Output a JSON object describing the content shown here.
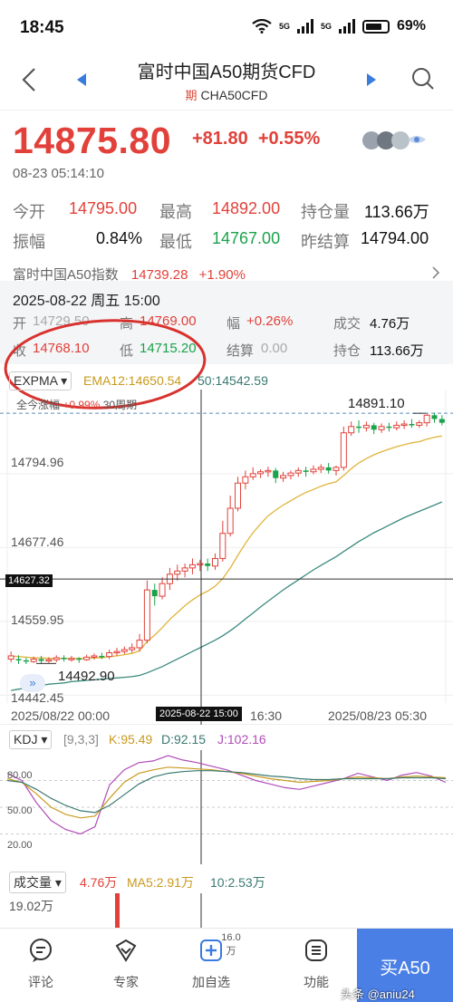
{
  "status_bar": {
    "time": "18:45",
    "net1": "5G",
    "net2": "5G",
    "battery": "69%"
  },
  "header": {
    "title": "富时中国A50期货CFD",
    "tag": "期",
    "code": "CHA50CFD"
  },
  "quote": {
    "price": "14875.80",
    "change": "+81.80",
    "change_pct": "+0.55%",
    "timestamp": "08-23 05:14:10"
  },
  "stats": [
    [
      {
        "label": "今开",
        "value": "14795.00",
        "color": "red"
      },
      {
        "label": "最高",
        "value": "14892.00",
        "color": "red"
      },
      {
        "label": "持仓量",
        "value": "113.66万",
        "color": "black"
      }
    ],
    [
      {
        "label": "振幅",
        "value": "0.84%",
        "color": "black"
      },
      {
        "label": "最低",
        "value": "14767.00",
        "color": "green"
      },
      {
        "label": "昨结算",
        "value": "14794.00",
        "color": "black"
      }
    ]
  ],
  "index_bar": {
    "name": "富时中国A50指数",
    "value": "14739.28",
    "change": "+1.90%"
  },
  "crosshair_info": {
    "date": "2025-08-22 周五 15:00",
    "open_label": "开",
    "open": "14729.50",
    "high_label": "高",
    "high": "14769.00",
    "amp_label": "幅",
    "amp": "+0.26%",
    "vol_label": "成交",
    "vol": "4.76万",
    "close_label": "收",
    "close": "14768.10",
    "low_label": "低",
    "low": "14715.20",
    "settle_label": "结算",
    "settle": "0.00",
    "oi_label": "持仓",
    "oi": "113.66万"
  },
  "main_chart": {
    "indicator": "EXPMA",
    "ema12": "EMA12:14650.54",
    "ema50": "50:14542.59",
    "range_note_label": "全今涨幅",
    "range_note_value": "+0.99%",
    "range_note_period": "30周期",
    "high_mark": "14891.10",
    "low_mark": "14492.90",
    "crosshair_price": "14627.32",
    "y_ticks": [
      "14794.96",
      "14677.46",
      "14559.95",
      "14442.45"
    ],
    "x_labels": [
      "2025/08/22 00:00",
      "2025-08-22 15:00",
      "16:30",
      "2025/08/23 05:30"
    ]
  },
  "kdj": {
    "indicator": "KDJ",
    "params": "[9,3,3]",
    "k": "K:95.49",
    "d": "D:92.15",
    "j": "J:102.16",
    "y_ticks": [
      "80.00",
      "50.00",
      "20.00"
    ]
  },
  "volume": {
    "indicator": "成交量",
    "vol": "4.76万",
    "ma5": "MA5:2.91万",
    "ma10": "10:2.53万",
    "y_tick": "19.02万"
  },
  "tabbar": {
    "comment": "评论",
    "expert": "专家",
    "add": "加自选",
    "add_badge": "16.0万",
    "func": "功能",
    "buy": "买A50",
    "watermark": "头条 @aniu24"
  },
  "colors": {
    "up": "#e1413a",
    "down": "#1aa34a",
    "ema12": "#e0b43a",
    "ema50": "#3a8a7e",
    "accent": "#4a7fe6"
  },
  "chart_data": {
    "type": "candlestick",
    "x": [
      "2025/08/22 00:00",
      "2025-08-22 15:00",
      "16:30",
      "2025/08/23 05:30"
    ],
    "ylim": [
      14442.45,
      14900
    ],
    "candles": [
      [
        14500,
        14505,
        14495,
        14512
      ],
      [
        14500,
        14498,
        14492,
        14506
      ],
      [
        14498,
        14496,
        14492,
        14502
      ],
      [
        14496,
        14500,
        14494,
        14504
      ],
      [
        14500,
        14497,
        14493,
        14505
      ],
      [
        14497,
        14499,
        14494,
        14503
      ],
      [
        14499,
        14502,
        14495,
        14506
      ],
      [
        14502,
        14500,
        14496,
        14506
      ],
      [
        14500,
        14501,
        14496,
        14505
      ],
      [
        14501,
        14499,
        14494,
        14503
      ],
      [
        14499,
        14503,
        14497,
        14507
      ],
      [
        14503,
        14505,
        14499,
        14509
      ],
      [
        14505,
        14504,
        14500,
        14510
      ],
      [
        14504,
        14510,
        14500,
        14515
      ],
      [
        14510,
        14512,
        14505,
        14518
      ],
      [
        14512,
        14515,
        14508,
        14520
      ],
      [
        14515,
        14518,
        14510,
        14525
      ],
      [
        14518,
        14530,
        14512,
        14540
      ],
      [
        14530,
        14610,
        14525,
        14625
      ],
      [
        14610,
        14600,
        14585,
        14620
      ],
      [
        14600,
        14620,
        14595,
        14630
      ],
      [
        14620,
        14635,
        14610,
        14645
      ],
      [
        14635,
        14640,
        14625,
        14650
      ],
      [
        14640,
        14645,
        14630,
        14652
      ],
      [
        14645,
        14650,
        14635,
        14660
      ],
      [
        14650,
        14652,
        14640,
        14658
      ],
      [
        14652,
        14648,
        14640,
        14660
      ],
      [
        14648,
        14660,
        14642,
        14668
      ],
      [
        14660,
        14700,
        14655,
        14720
      ],
      [
        14700,
        14740,
        14695,
        14760
      ],
      [
        14740,
        14780,
        14735,
        14790
      ],
      [
        14780,
        14790,
        14770,
        14800
      ],
      [
        14790,
        14795,
        14785,
        14805
      ],
      [
        14795,
        14798,
        14788,
        14802
      ],
      [
        14798,
        14800,
        14790,
        14806
      ],
      [
        14800,
        14788,
        14780,
        14804
      ],
      [
        14788,
        14792,
        14782,
        14798
      ],
      [
        14792,
        14796,
        14786,
        14800
      ],
      [
        14796,
        14800,
        14790,
        14805
      ],
      [
        14800,
        14798,
        14790,
        14806
      ],
      [
        14798,
        14802,
        14794,
        14808
      ],
      [
        14802,
        14805,
        14796,
        14810
      ],
      [
        14805,
        14800,
        14795,
        14812
      ],
      [
        14800,
        14805,
        14792,
        14808
      ],
      [
        14805,
        14860,
        14800,
        14870
      ],
      [
        14860,
        14870,
        14855,
        14878
      ],
      [
        14870,
        14868,
        14860,
        14880
      ],
      [
        14868,
        14872,
        14862,
        14878
      ],
      [
        14872,
        14865,
        14858,
        14876
      ],
      [
        14865,
        14870,
        14860,
        14875
      ],
      [
        14870,
        14868,
        14862,
        14876
      ],
      [
        14868,
        14872,
        14864,
        14878
      ],
      [
        14872,
        14874,
        14866,
        14880
      ],
      [
        14874,
        14872,
        14868,
        14882
      ],
      [
        14872,
        14876,
        14868,
        14880
      ],
      [
        14876,
        14888,
        14870,
        14891
      ],
      [
        14888,
        14882,
        14876,
        14892
      ],
      [
        14882,
        14876,
        14872,
        14888
      ]
    ],
    "series": [
      {
        "name": "EMA12",
        "values": [
          14505,
          14504,
          14503,
          14502,
          14502,
          14501,
          14501,
          14501,
          14501,
          14501,
          14501,
          14502,
          14502,
          14504,
          14505,
          14507,
          14509,
          14513,
          14528,
          14538,
          14550,
          14563,
          14574,
          14585,
          14594,
          14602,
          14608,
          14616,
          14628,
          14645,
          14665,
          14684,
          14701,
          14715,
          14728,
          14737,
          14745,
          14752,
          14759,
          14765,
          14770,
          14775,
          14779,
          14782,
          14792,
          14803,
          14812,
          14819,
          14825,
          14830,
          14834,
          14838,
          14841,
          14844,
          14846,
          14850,
          14853,
          14855
        ]
      },
      {
        "name": "50",
        "values": [
          14450,
          14452,
          14454,
          14456,
          14458,
          14460,
          14461,
          14462,
          14464,
          14465,
          14466,
          14467,
          14468,
          14469,
          14470,
          14471,
          14472,
          14474,
          14478,
          14483,
          14488,
          14494,
          14500,
          14506,
          14512,
          14518,
          14524,
          14530,
          14537,
          14545,
          14554,
          14564,
          14573,
          14583,
          14592,
          14601,
          14610,
          14618,
          14626,
          14634,
          14642,
          14649,
          14656,
          14663,
          14671,
          14679,
          14687,
          14694,
          14701,
          14707,
          14713,
          14719,
          14725,
          14730,
          14735,
          14740,
          14745,
          14750
        ]
      }
    ]
  }
}
